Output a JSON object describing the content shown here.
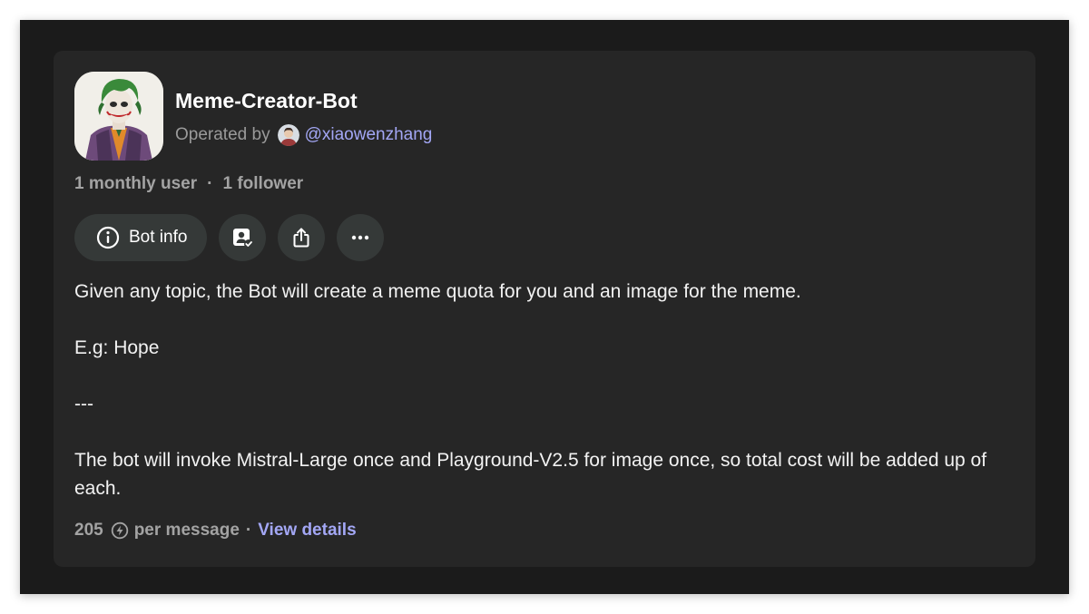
{
  "bot": {
    "name": "Meme-Creator-Bot",
    "operated_by_label": "Operated by",
    "operator_handle": "@xiaowenzhang",
    "avatar_icon": "joker-portrait-avatar"
  },
  "stats": {
    "monthly_users": "1 monthly user",
    "separator": "·",
    "followers": "1 follower"
  },
  "actions": {
    "bot_info_label": "Bot info",
    "icons": [
      "info-icon",
      "user-badge-check-icon",
      "share-icon",
      "more-icon"
    ]
  },
  "description": {
    "line1": "Given any topic, the Bot will create a meme quota for you and an image for the meme.",
    "line2": "E.g: Hope",
    "line3": "---",
    "line4": "The bot will invoke Mistral-Large once and Playground-V2.5 for image once, so total cost will be added up of each."
  },
  "footer": {
    "cost": "205",
    "per_message": "per message",
    "separator": "·",
    "view_details": "View details"
  },
  "colors": {
    "background": "#1b1b1b",
    "card": "#262626",
    "button": "#353938",
    "accent_link": "#a3a7f5",
    "muted_text": "#a3a3a3"
  }
}
